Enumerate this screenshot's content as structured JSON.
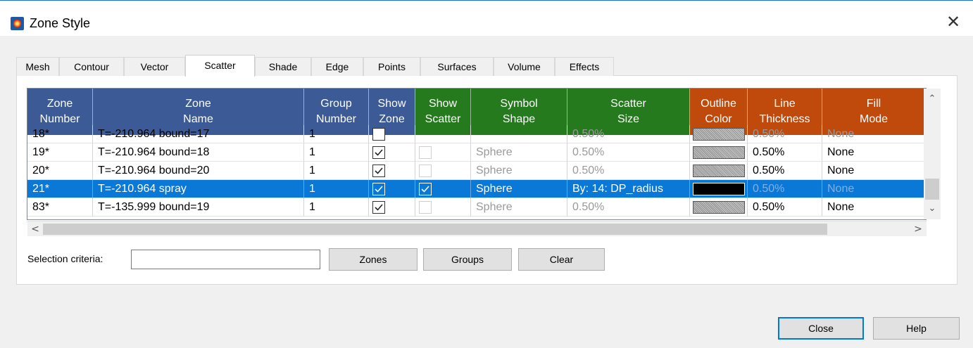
{
  "window": {
    "title": "Zone Style",
    "close_glyph": "✕",
    "app_icon": "tecplot-icon"
  },
  "tabs": [
    {
      "label": "Mesh",
      "active": false
    },
    {
      "label": "Contour",
      "active": false
    },
    {
      "label": "Vector",
      "active": false
    },
    {
      "label": "Scatter",
      "active": true
    },
    {
      "label": "Shade",
      "active": false
    },
    {
      "label": "Edge",
      "active": false
    },
    {
      "label": "Points",
      "active": false
    },
    {
      "label": "Surfaces",
      "active": false
    },
    {
      "label": "Volume",
      "active": false
    },
    {
      "label": "Effects",
      "active": false
    }
  ],
  "grid": {
    "columns": [
      {
        "label": "Zone\nNumber",
        "group": "blue"
      },
      {
        "label": "Zone\nName",
        "group": "blue"
      },
      {
        "label": "Group\nNumber",
        "group": "blue"
      },
      {
        "label": "Show\nZone",
        "group": "blue"
      },
      {
        "label": "Show\nScatter",
        "group": "green"
      },
      {
        "label": "Symbol\nShape",
        "group": "green"
      },
      {
        "label": "Scatter\nSize",
        "group": "green"
      },
      {
        "label": "Outline\nColor",
        "group": "orange"
      },
      {
        "label": "Line\nThickness",
        "group": "orange"
      },
      {
        "label": "Fill\nMode",
        "group": "orange"
      }
    ],
    "header_colors": {
      "blue": "#3c5a96",
      "green": "#267a1e",
      "orange": "#c04a0c"
    },
    "partial_row": {
      "number": "18*",
      "name": "T=-210.964 bound=17",
      "group": "1",
      "size": "0.50%",
      "thickness": "0.50%",
      "fill": "None"
    },
    "rows": [
      {
        "number": "19*",
        "name": "T=-210.964 bound=18",
        "group": "1",
        "show_zone": true,
        "show_scatter": false,
        "shape": "Sphere",
        "size": "0.50%",
        "outline": "pattern",
        "thickness": "0.50%",
        "fill": "None",
        "selected": false
      },
      {
        "number": "20*",
        "name": "T=-210.964 bound=20",
        "group": "1",
        "show_zone": true,
        "show_scatter": false,
        "shape": "Sphere",
        "size": "0.50%",
        "outline": "pattern",
        "thickness": "0.50%",
        "fill": "None",
        "selected": false
      },
      {
        "number": "21*",
        "name": "T=-210.964 spray",
        "group": "1",
        "show_zone": true,
        "show_scatter": true,
        "shape": "Sphere",
        "size": "By: 14: DP_radius",
        "outline": "black",
        "thickness": "0.50%",
        "fill": "None",
        "selected": true
      },
      {
        "number": "83*",
        "name": "T=-135.999 bound=19",
        "group": "1",
        "show_zone": true,
        "show_scatter": false,
        "shape": "Sphere",
        "size": "0.50%",
        "outline": "pattern",
        "thickness": "0.50%",
        "fill": "None",
        "selected": false
      }
    ]
  },
  "selection": {
    "label": "Selection criteria:",
    "value": ""
  },
  "buttons": {
    "zones": "Zones",
    "groups": "Groups",
    "clear": "Clear",
    "close": "Close",
    "help": "Help"
  },
  "scroll": {
    "up": "^",
    "down": "v",
    "left": "<",
    "right": ">"
  }
}
